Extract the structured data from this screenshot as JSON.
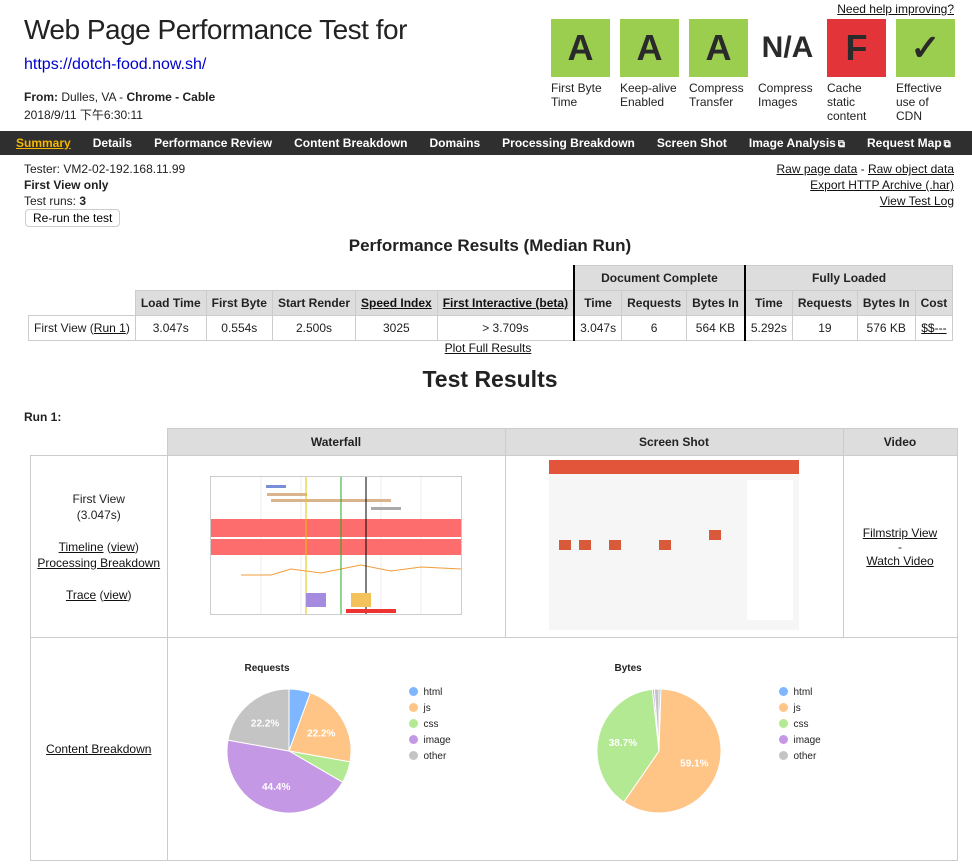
{
  "header": {
    "title": "Web Page Performance Test for",
    "url": "https://dotch-food.now.sh/",
    "from_label": "From:",
    "from_location": "Dulles, VA -",
    "from_browser": "Chrome - Cable",
    "date": "2018/9/11 下午6:30:11",
    "help_link": "Need help improving?"
  },
  "grades": [
    {
      "grade": "A",
      "label": "First Byte Time",
      "color": "#9bce4f"
    },
    {
      "grade": "A",
      "label": "Keep-alive Enabled",
      "color": "#9bce4f"
    },
    {
      "grade": "A",
      "label": "Compress Transfer",
      "color": "#9bce4f"
    },
    {
      "grade": "N/A",
      "label": "Compress Images",
      "color": "#ffffff"
    },
    {
      "grade": "F",
      "label": "Cache static content",
      "color": "#e3343a"
    },
    {
      "grade": "✓",
      "label": "Effective use of CDN",
      "color": "#9bce4f"
    }
  ],
  "nav": [
    "Summary",
    "Details",
    "Performance Review",
    "Content Breakdown",
    "Domains",
    "Processing Breakdown",
    "Screen Shot",
    "Image Analysis",
    "Request Map"
  ],
  "nav_external_icon": "external-link-icon",
  "info": {
    "tester": "Tester: VM2-02-192.168.11.99",
    "view": "First View only",
    "runs_label": "Test runs:",
    "runs": "3",
    "rerun": "Re-run the test"
  },
  "links": {
    "raw_page": "Raw page data",
    "sep": "-",
    "raw_object": "Raw object data",
    "har": "Export HTTP Archive (.har)",
    "log": "View Test Log"
  },
  "performance": {
    "title": "Performance Results (Median Run)",
    "group_doc": "Document Complete",
    "group_full": "Fully Loaded",
    "headers": [
      "Load Time",
      "First Byte",
      "Start Render",
      "Speed Index",
      "First Interactive (beta)",
      "Time",
      "Requests",
      "Bytes In",
      "Time",
      "Requests",
      "Bytes In",
      "Cost"
    ],
    "row_label": "First View (",
    "row_link": "Run 1",
    "row_close": ")",
    "values": [
      "3.047s",
      "0.554s",
      "2.500s",
      "3025",
      "> 3.709s",
      "3.047s",
      "6",
      "564 KB",
      "5.292s",
      "19",
      "576 KB",
      "$$---"
    ],
    "plot_link": "Plot Full Results"
  },
  "test_results": {
    "title": "Test Results",
    "run_label": "Run 1:",
    "columns": [
      "Waterfall",
      "Screen Shot",
      "Video"
    ],
    "first_view": "First View",
    "first_view_time": "(3.047s)",
    "timeline": "Timeline",
    "view": "view",
    "processing": "Processing Breakdown",
    "trace": "Trace",
    "filmstrip": "Filmstrip View",
    "dash": "-",
    "watch": "Watch Video",
    "content_breakdown": "Content Breakdown"
  },
  "chart_data": [
    {
      "type": "pie",
      "title": "Requests",
      "categories": [
        "html",
        "js",
        "css",
        "image",
        "other"
      ],
      "values": [
        5.6,
        22.2,
        5.6,
        44.4,
        22.2
      ],
      "labels": [
        "",
        "22.2%",
        "",
        "44.4%",
        "22.2%"
      ],
      "colors": [
        "#7eb6ff",
        "#ffc587",
        "#b3e993",
        "#c598e6",
        "#c4c4c4"
      ],
      "legend": "right"
    },
    {
      "type": "pie",
      "title": "Bytes",
      "categories": [
        "html",
        "js",
        "css",
        "image",
        "other"
      ],
      "values": [
        0.5,
        59.1,
        38.7,
        0.5,
        1.2
      ],
      "labels": [
        "",
        "59.1%",
        "38.7%",
        "",
        ""
      ],
      "colors": [
        "#7eb6ff",
        "#ffc587",
        "#b3e993",
        "#c598e6",
        "#c4c4c4"
      ],
      "legend": "right"
    }
  ]
}
